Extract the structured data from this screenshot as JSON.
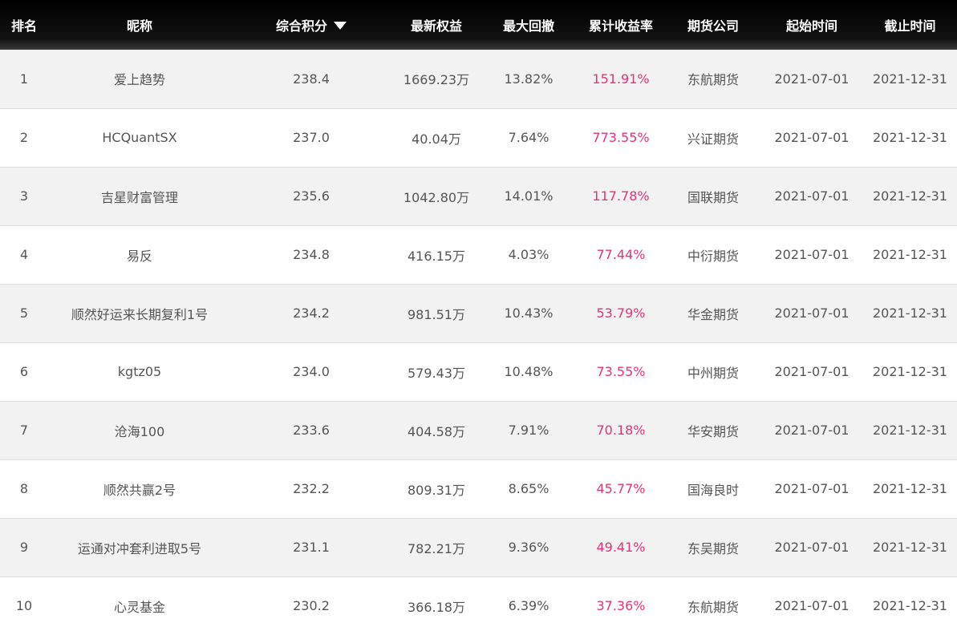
{
  "table": {
    "headers": {
      "rank": "排名",
      "nickname": "昵称",
      "score": "综合积分",
      "equity": "最新权益",
      "drawdown": "最大回撤",
      "return": "累计收益率",
      "company": "期货公司",
      "start": "起始时间",
      "end": "截止时间"
    },
    "sort_icon": "triangle-down-icon",
    "return_color": "#e6317a",
    "header_bg": "#000000",
    "rows": [
      {
        "rank": "1",
        "nickname": "爱上趋势",
        "score": "238.4",
        "equity": "1669.23万",
        "drawdown": "13.82%",
        "return": "151.91%",
        "company": "东航期货",
        "start": "2021-07-01",
        "end": "2021-12-31"
      },
      {
        "rank": "2",
        "nickname": "HCQuantSX",
        "score": "237.0",
        "equity": "40.04万",
        "drawdown": "7.64%",
        "return": "773.55%",
        "company": "兴证期货",
        "start": "2021-07-01",
        "end": "2021-12-31"
      },
      {
        "rank": "3",
        "nickname": "吉星财富管理",
        "score": "235.6",
        "equity": "1042.80万",
        "drawdown": "14.01%",
        "return": "117.78%",
        "company": "国联期货",
        "start": "2021-07-01",
        "end": "2021-12-31"
      },
      {
        "rank": "4",
        "nickname": "易反",
        "score": "234.8",
        "equity": "416.15万",
        "drawdown": "4.03%",
        "return": "77.44%",
        "company": "中衍期货",
        "start": "2021-07-01",
        "end": "2021-12-31"
      },
      {
        "rank": "5",
        "nickname": "顺然好运来长期复利1号",
        "score": "234.2",
        "equity": "981.51万",
        "drawdown": "10.43%",
        "return": "53.79%",
        "company": "华金期货",
        "start": "2021-07-01",
        "end": "2021-12-31"
      },
      {
        "rank": "6",
        "nickname": "kgtz05",
        "score": "234.0",
        "equity": "579.43万",
        "drawdown": "10.48%",
        "return": "73.55%",
        "company": "中州期货",
        "start": "2021-07-01",
        "end": "2021-12-31"
      },
      {
        "rank": "7",
        "nickname": "沧海100",
        "score": "233.6",
        "equity": "404.58万",
        "drawdown": "7.91%",
        "return": "70.18%",
        "company": "华安期货",
        "start": "2021-07-01",
        "end": "2021-12-31"
      },
      {
        "rank": "8",
        "nickname": "顺然共赢2号",
        "score": "232.2",
        "equity": "809.31万",
        "drawdown": "8.65%",
        "return": "45.77%",
        "company": "国海良时",
        "start": "2021-07-01",
        "end": "2021-12-31"
      },
      {
        "rank": "9",
        "nickname": "运通对冲套利进取5号",
        "score": "231.1",
        "equity": "782.21万",
        "drawdown": "9.36%",
        "return": "49.41%",
        "company": "东吴期货",
        "start": "2021-07-01",
        "end": "2021-12-31"
      },
      {
        "rank": "10",
        "nickname": "心灵基金",
        "score": "230.2",
        "equity": "366.18万",
        "drawdown": "6.39%",
        "return": "37.36%",
        "company": "东航期货",
        "start": "2021-07-01",
        "end": "2021-12-31"
      }
    ]
  }
}
